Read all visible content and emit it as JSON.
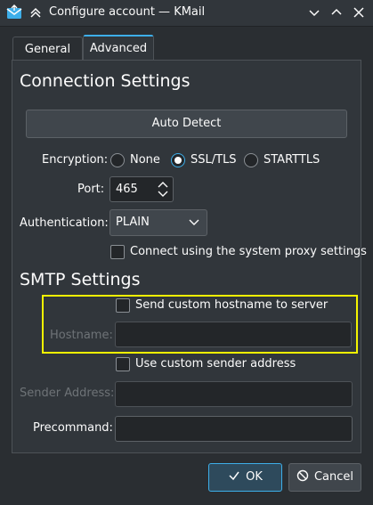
{
  "window": {
    "title": "Configure account — KMail",
    "icons": {
      "app": "kmail-icon",
      "keep_above": "chevron-up-icon",
      "minimize": "minimize-icon",
      "maximize": "maximize-icon",
      "close": "close-icon"
    }
  },
  "tabs": [
    {
      "label": "General",
      "active": false
    },
    {
      "label": "Advanced",
      "active": true
    }
  ],
  "connection": {
    "title": "Connection Settings",
    "auto_detect_label": "Auto Detect",
    "encryption": {
      "label": "Encryption:",
      "options": [
        "None",
        "SSL/TLS",
        "STARTTLS"
      ],
      "selected": "SSL/TLS"
    },
    "port": {
      "label": "Port:",
      "value": "465"
    },
    "authentication": {
      "label": "Authentication:",
      "value": "PLAIN"
    },
    "proxy": {
      "label": "Connect using the system proxy settings",
      "checked": false
    }
  },
  "smtp": {
    "title": "SMTP Settings",
    "custom_hostname": {
      "label": "Send custom hostname to server",
      "checked": false
    },
    "hostname": {
      "label": "Hostname:",
      "value": ""
    },
    "custom_sender": {
      "label": "Use custom sender address",
      "checked": false
    },
    "sender_address": {
      "label": "Sender Address:",
      "value": ""
    },
    "precommand": {
      "label": "Precommand:",
      "value": ""
    }
  },
  "footer": {
    "ok_label": "OK",
    "cancel_label": "Cancel"
  },
  "colors": {
    "accent": "#3daee9",
    "highlight": "#f5f500",
    "background": "#31363b"
  }
}
